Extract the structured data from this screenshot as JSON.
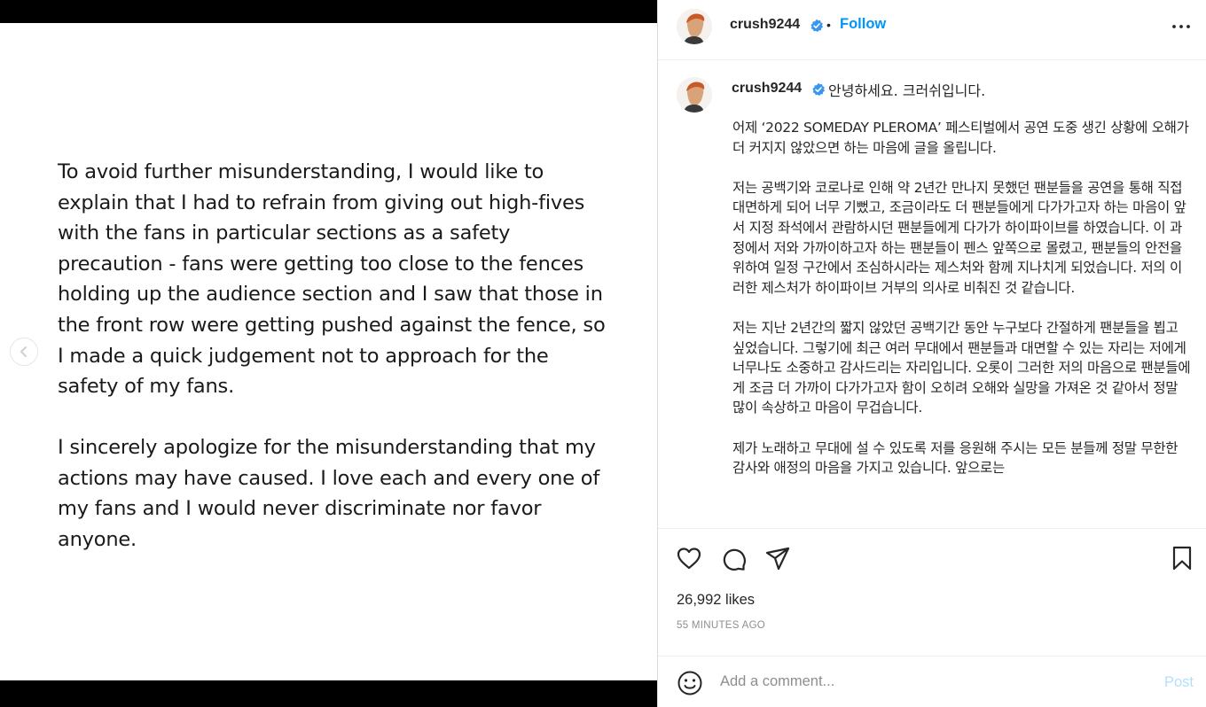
{
  "media": {
    "paragraph1": "To avoid further misunderstanding, I would like to explain that I had to refrain from giving out high-fives with the fans in particular sections as a safety precaution - fans were getting too close to the fences holding up the audience section and I saw that those in the front row were getting pushed against the fence, so I made a quick judgement not to approach for the safety of my fans.",
    "paragraph2": "I sincerely apologize for the misunderstanding that my actions may have caused. I love each and every one of my fans and I would never discriminate nor favor anyone.",
    "prev_icon": "chevron-left-icon"
  },
  "header": {
    "username": "crush9244",
    "dot": "•",
    "follow_label": "Follow",
    "more_icon": "more-horizontal-icon"
  },
  "caption": {
    "username": "crush9244",
    "greeting": "안녕하세요. 크러쉬입니다.",
    "paragraphs": [
      "어제 ‘2022 SOMEDAY PLEROMA’ 페스티벌에서 공연 도중 생긴 상황에 오해가 더 커지지 않았으면 하는 마음에 글을 올립니다.",
      "저는 공백기와 코로나로 인해 약 2년간 만나지 못했던 팬분들을 공연을 통해 직접 대면하게 되어 너무 기뻤고, 조금이라도 더 팬분들에게 다가가고자 하는 마음이 앞서 지정 좌석에서 관람하시던 팬분들에게 다가가 하이파이브를 하였습니다. 이 과정에서 저와 가까이하고자 하는 팬분들이 펜스 앞쪽으로 몰렸고, 팬분들의 안전을 위하여 일정 구간에서 조심하시라는 제스처와 함께 지나치게 되었습니다. 저의 이러한 제스처가 하이파이브 거부의 의사로 비춰진 것 같습니다.",
      "저는 지난 2년간의 짧지 않았던 공백기간 동안 누구보다 간절하게 팬분들을 뵙고 싶었습니다. 그렇기에 최근 여러 무대에서 팬분들과 대면할 수 있는 자리는 저에게 너무나도 소중하고 감사드리는 자리입니다. 오롯이 그러한 저의 마음으로 팬분들에게 조금 더 가까이 다가가고자 함이 오히려 오해와 실망을 가져온 것 같아서 정말 많이 속상하고 마음이 무겁습니다.",
      "제가 노래하고 무대에 설 수 있도록 저를 응원해 주시는 모든 분들께 정말 무한한 감사와 애정의 마음을 가지고 있습니다. 앞으로는"
    ]
  },
  "actions": {
    "like_icon": "heart-icon",
    "comment_icon": "comment-icon",
    "share_icon": "send-icon",
    "save_icon": "bookmark-icon"
  },
  "likes_text": "26,992 likes",
  "timestamp": "55 MINUTES AGO",
  "comment": {
    "placeholder": "Add a comment...",
    "post_label": "Post",
    "emoji_icon": "smiley-icon"
  },
  "colors": {
    "accent": "#0095f6",
    "verified": "#3897f0",
    "post_disabled": "#b2dffc",
    "muted": "#8e8e8e"
  }
}
